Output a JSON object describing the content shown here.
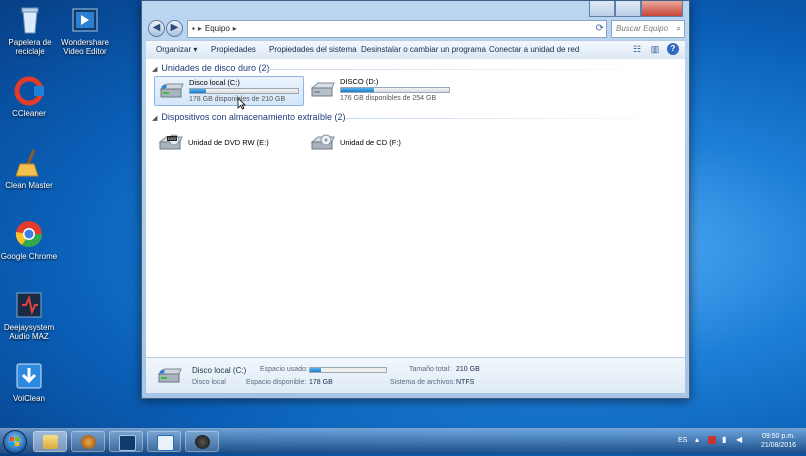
{
  "desktop": {
    "icons": [
      {
        "label": "Papelera de\nreciclaje",
        "icon": "recycle-bin-icon"
      },
      {
        "label": "Wondershare\nVideo Editor",
        "icon": "video-editor-icon"
      },
      {
        "label": "CCleaner",
        "icon": "ccleaner-icon"
      },
      {
        "label": "Clean Master",
        "icon": "broom-icon"
      },
      {
        "label": "Google Chrome",
        "icon": "chrome-icon"
      },
      {
        "label": "Deejaysystem\nAudio MAZ",
        "icon": "audio-app-icon"
      },
      {
        "label": "VoiClean",
        "icon": "download-arrow-icon"
      }
    ]
  },
  "window": {
    "breadcrumb": [
      "Equipo"
    ],
    "search_placeholder": "Buscar Equipo",
    "toolbar": {
      "organize": "Organizar",
      "properties": "Propiedades",
      "system_properties": "Propiedades del sistema",
      "uninstall": "Desinstalar o cambiar un programa",
      "map_drive": "Conectar a unidad de red"
    },
    "groups": [
      {
        "title": "Unidades de disco duro (2)",
        "drives": [
          {
            "name": "Disco local (C:)",
            "free_text": "178 GB disponibles de 210 GB",
            "used_fraction": 0.15,
            "selected": true
          },
          {
            "name": "DISCO  (D:)",
            "free_text": "176 GB disponibles de 254 GB",
            "used_fraction": 0.31,
            "selected": false
          }
        ]
      },
      {
        "title": "Dispositivos con almacenamiento extraíble (2)",
        "drives": [
          {
            "name": "Unidad de DVD RW (E:)",
            "icon": "dvd-drive-icon"
          },
          {
            "name": "Unidad de CD (F:)",
            "icon": "cd-drive-icon"
          }
        ]
      }
    ],
    "details": {
      "name": "Disco local (C:)",
      "type": "Disco local",
      "used_label": "Espacio usado:",
      "used_fraction": 0.15,
      "free_label": "Espacio disponible:",
      "free_value": "178 GB",
      "total_label": "Tamaño total:",
      "total_value": "210 GB",
      "fs_label": "Sistema de archivos:",
      "fs_value": "NTFS"
    }
  },
  "taskbar": {
    "language": "ES",
    "time": "09:50 p.m.",
    "date": "21/08/2016"
  },
  "colors": {
    "accent": "#1c7ccc",
    "header_text": "#1e3c78"
  }
}
